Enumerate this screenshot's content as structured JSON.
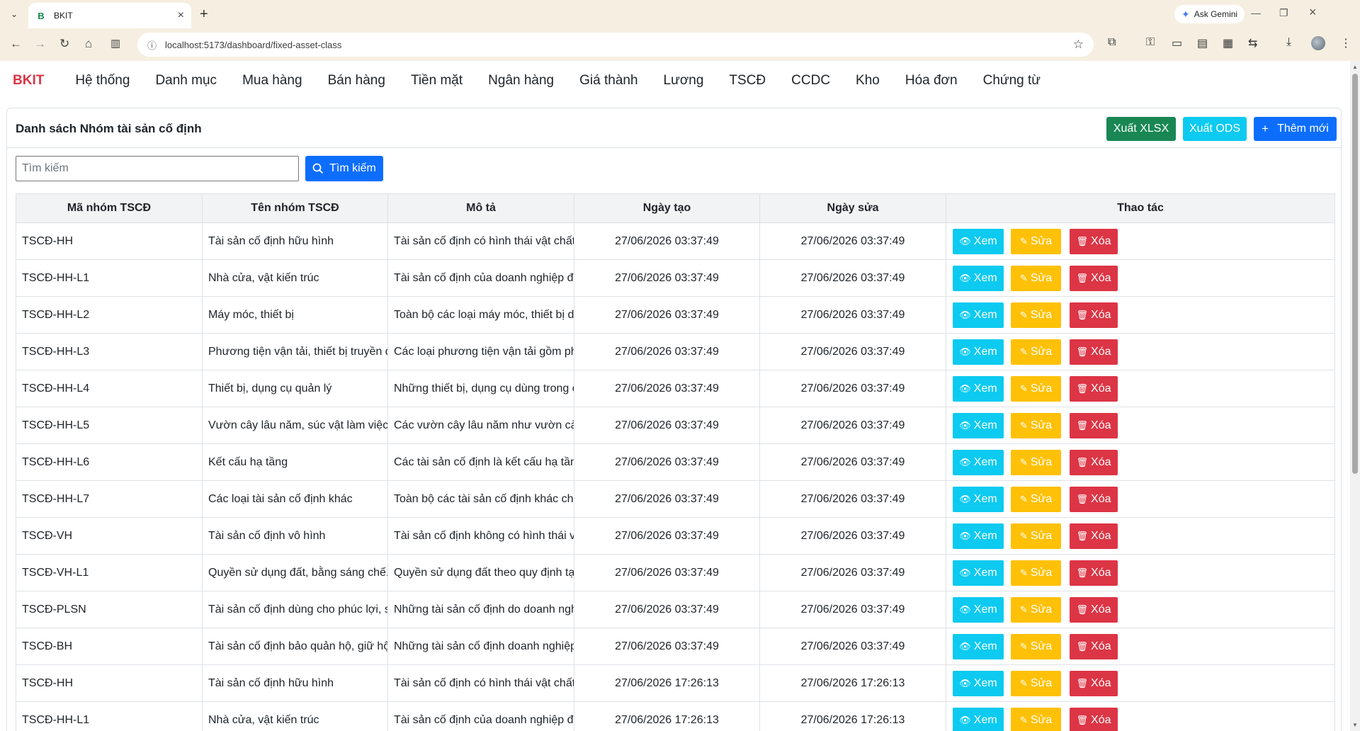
{
  "browser": {
    "tab_title": "BKIT",
    "tab_favicon": "B",
    "url": "localhost:5173/dashboard/fixed-asset-class",
    "gemini_label": "Ask Gemini"
  },
  "nav": {
    "brand": "BKIT",
    "items": [
      "Hệ thống",
      "Danh mục",
      "Mua hàng",
      "Bán hàng",
      "Tiền mặt",
      "Ngân hàng",
      "Giá thành",
      "Lương",
      "TSCĐ",
      "CCDC",
      "Kho",
      "Hóa đơn",
      "Chứng từ"
    ]
  },
  "page": {
    "title": "Danh sách Nhóm tài sản cố định",
    "export_xlsx": "Xuất XLSX",
    "export_ods": "Xuất ODS",
    "add_new": "Thêm mới",
    "search_placeholder": "Tìm kiếm",
    "search_button": "Tìm kiếm"
  },
  "table": {
    "columns": [
      "Mã nhóm TSCĐ",
      "Tên nhóm TSCĐ",
      "Mô tả",
      "Ngày tạo",
      "Ngày sửa",
      "Thao tác"
    ],
    "actions": {
      "view": "Xem",
      "edit": "Sửa",
      "delete": "Xóa"
    },
    "rows": [
      [
        "TSCĐ-HH",
        "Tài sản cố định hữu hình",
        "Tài sản cố định có hình thái vật chất do do",
        "27/06/2026 03:37:49",
        "27/06/2026 03:37:49"
      ],
      [
        "TSCĐ-HH-L1",
        "Nhà cửa, vật kiến trúc",
        "Tài sản cố định của doanh nghiệp được h",
        "27/06/2026 03:37:49",
        "27/06/2026 03:37:49"
      ],
      [
        "TSCĐ-HH-L2",
        "Máy móc, thiết bị",
        "Toàn bộ các loại máy móc, thiết bị dùng tr",
        "27/06/2026 03:37:49",
        "27/06/2026 03:37:49"
      ],
      [
        "TSCĐ-HH-L3",
        "Phương tiện vận tải, thiết bị truyền dẫn",
        "Các loại phương tiện vận tải gồm phương",
        "27/06/2026 03:37:49",
        "27/06/2026 03:37:49"
      ],
      [
        "TSCĐ-HH-L4",
        "Thiết bị, dụng cụ quản lý",
        "Những thiết bị, dụng cụ dùng trong công t",
        "27/06/2026 03:37:49",
        "27/06/2026 03:37:49"
      ],
      [
        "TSCĐ-HH-L5",
        "Vườn cây lâu năm, súc vật làm việc và/ho",
        "Các vườn cây lâu năm như vườn cà phê,",
        "27/06/2026 03:37:49",
        "27/06/2026 03:37:49"
      ],
      [
        "TSCĐ-HH-L6",
        "Kết cấu hạ tầng",
        "Các tài sản cố định là kết cấu hạ tầng, có",
        "27/06/2026 03:37:49",
        "27/06/2026 03:37:49"
      ],
      [
        "TSCĐ-HH-L7",
        "Các loại tài sản cố định khác",
        "Toàn bộ các tài sản cố định khác chưa liệ",
        "27/06/2026 03:37:49",
        "27/06/2026 03:37:49"
      ],
      [
        "TSCĐ-VH",
        "Tài sản cố định vô hình",
        "Tài sản cố định không có hình thái vật chấ",
        "27/06/2026 03:37:49",
        "27/06/2026 03:37:49"
      ],
      [
        "TSCĐ-VH-L1",
        "Quyền sử dụng đất, bằng sáng chế...",
        "Quyền sử dụng đất theo quy định tại điểm",
        "27/06/2026 03:37:49",
        "27/06/2026 03:37:49"
      ],
      [
        "TSCĐ-PLSN",
        "Tài sản cố định dùng cho phúc lợi, sự ngh",
        "Những tài sản cố định do doanh nghiệp q",
        "27/06/2026 03:37:49",
        "27/06/2026 03:37:49"
      ],
      [
        "TSCĐ-BH",
        "Tài sản cố định bảo quản hộ, giữ hộ, cất g",
        "Những tài sản cố định doanh nghiệp bảo",
        "27/06/2026 03:37:49",
        "27/06/2026 03:37:49"
      ],
      [
        "TSCĐ-HH",
        "Tài sản cố định hữu hình",
        "Tài sản cố định có hình thái vật chất do do",
        "27/06/2026 17:26:13",
        "27/06/2026 17:26:13"
      ],
      [
        "TSCĐ-HH-L1",
        "Nhà cửa, vật kiến trúc",
        "Tài sản cố định của doanh nghiệp được h",
        "27/06/2026 17:26:13",
        "27/06/2026 17:26:13"
      ]
    ]
  },
  "colors": {
    "brand": "#dc3545",
    "success": "#198754",
    "info": "#0dcaf0",
    "primary": "#0d6efd",
    "warning": "#ffc107",
    "danger": "#dc3545"
  }
}
